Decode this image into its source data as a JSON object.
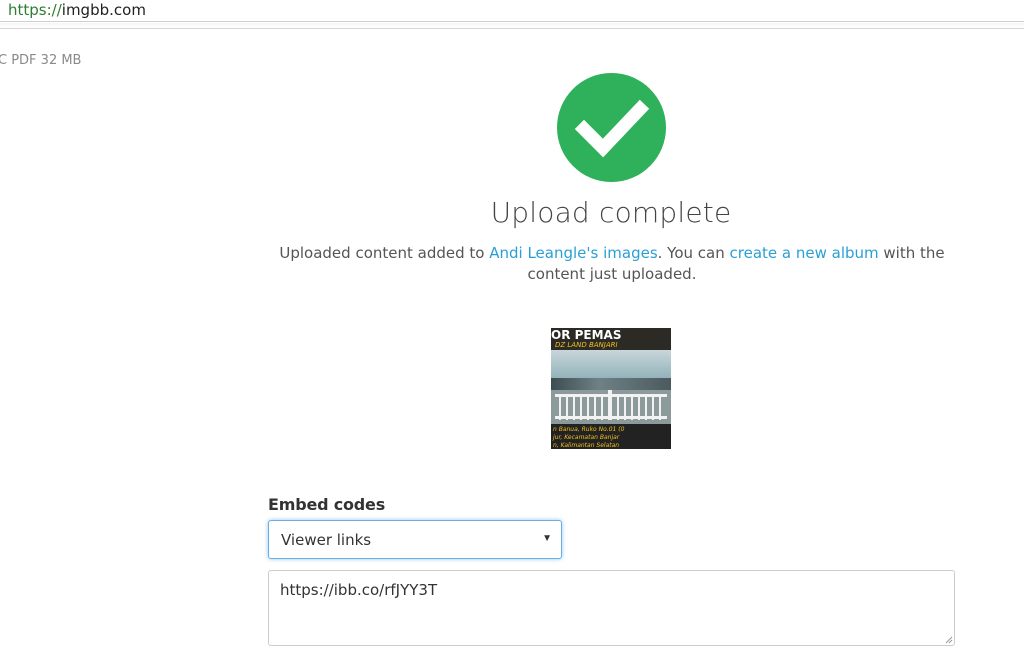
{
  "browser": {
    "url_scheme": "https://",
    "url_host": "imgbb.com"
  },
  "side_note": "C PDF  32 MB",
  "upload": {
    "status_icon": "checkmark-icon",
    "status_color": "#2eb15a",
    "title": "Upload complete",
    "desc_prefix": "Uploaded content added to ",
    "owner_link": "Andi Leangle's images",
    "desc_middle": ". You can ",
    "album_link": "create a new album",
    "desc_suffix": " with the content just uploaded.",
    "link_color": "#2a9fd6"
  },
  "thumbnail": {
    "top_text": "OR PEMAS",
    "sub_text": "DZ LAND BANJARI",
    "bottom_line1": "n Banua, Ruko No.01 (0",
    "bottom_line2": "jur, Kecamatan Banjar",
    "bottom_line3": "n, Kalimantan Selatan"
  },
  "embed": {
    "label": "Embed codes",
    "select_value": "Viewer links",
    "textarea_value": "https://ibb.co/rfJYY3T"
  }
}
